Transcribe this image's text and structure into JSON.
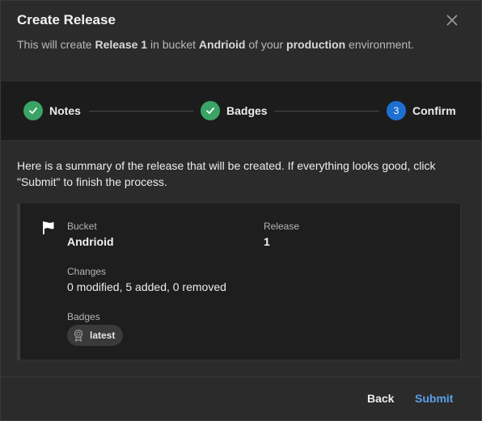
{
  "dialog": {
    "title": "Create Release",
    "subtitle": {
      "part1": "This will create ",
      "release_name": "Release 1",
      "part2": " in bucket ",
      "bucket_name": "Andrioid",
      "part3": " of your ",
      "environment": "production",
      "part4": " environment."
    }
  },
  "stepper": {
    "steps": [
      {
        "label": "Notes",
        "status": "complete",
        "icon": "check-icon"
      },
      {
        "label": "Badges",
        "status": "complete",
        "icon": "check-icon"
      },
      {
        "label": "Confirm",
        "status": "active",
        "number": "3"
      }
    ]
  },
  "summary": {
    "text": "Here is a summary of the release that will be created. If everything looks good, click \"Submit\" to finish the process."
  },
  "details": {
    "icon": "flag-icon",
    "bucket_label": "Bucket",
    "bucket_value": "Andrioid",
    "release_label": "Release",
    "release_value": "1",
    "changes_label": "Changes",
    "changes_value": "0 modified, 5 added, 0 removed",
    "badges_label": "Badges",
    "badges": [
      {
        "label": "latest",
        "icon": "medal-icon"
      }
    ]
  },
  "footer": {
    "back_label": "Back",
    "submit_label": "Submit"
  },
  "colors": {
    "complete": "#3aa366",
    "active": "#1f6fd1",
    "submit_text": "#5aa0e8"
  }
}
